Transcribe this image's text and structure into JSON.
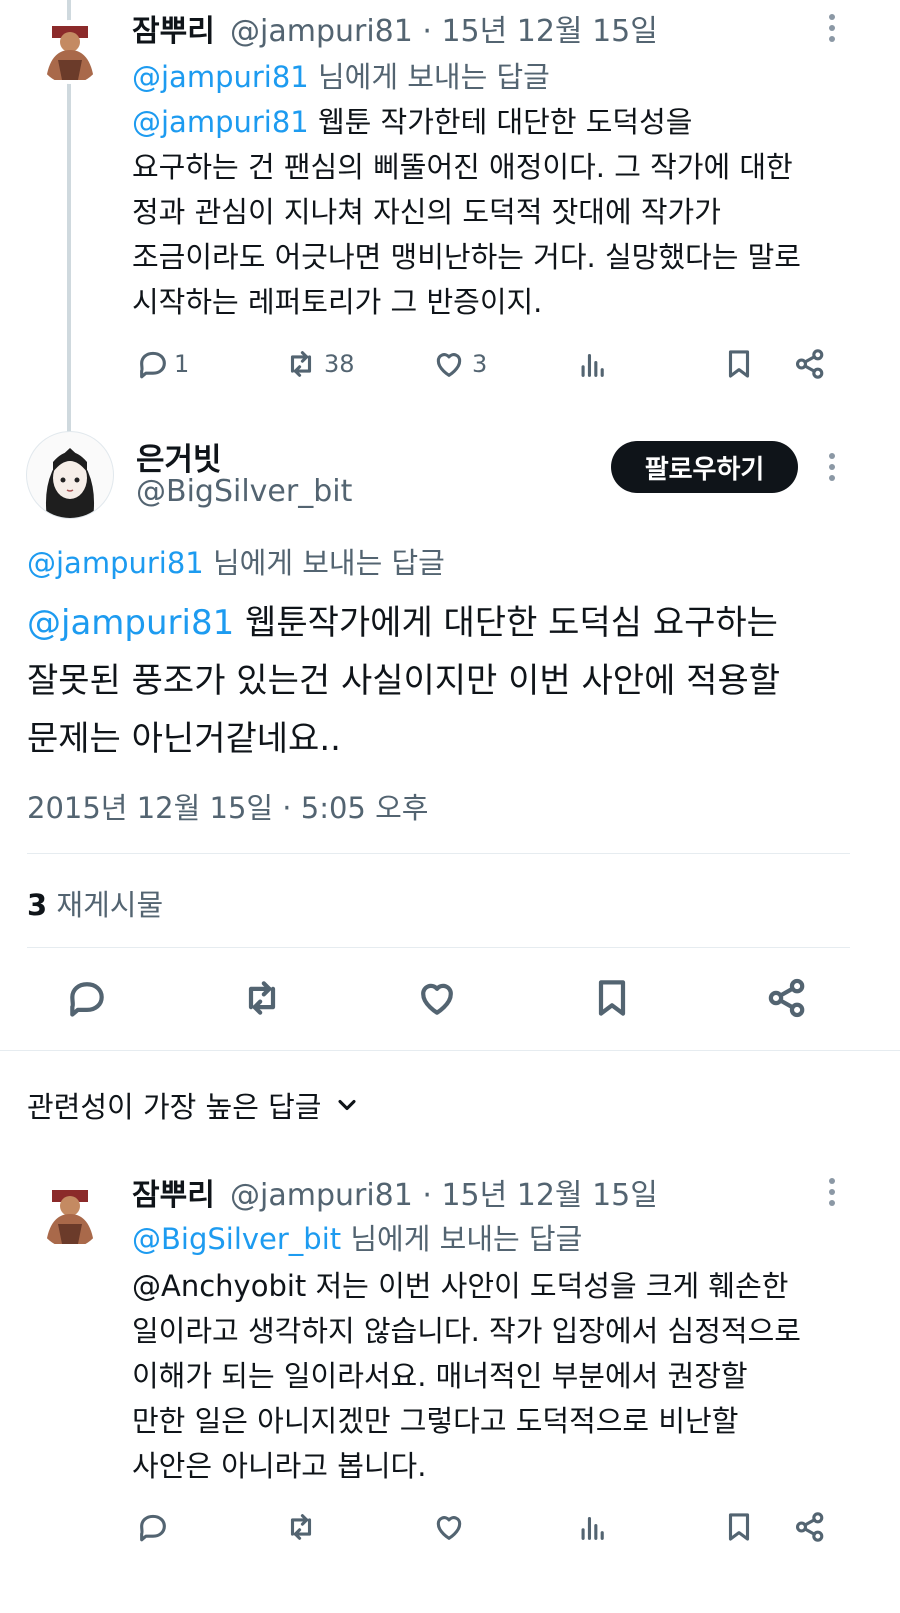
{
  "tweet1": {
    "name": "잠뿌리",
    "handle_date": "@jampuri81 · 15년 12월 15일",
    "reply_to_handle": "@jampuri81",
    "reply_to_suffix": " 님에게 보내는 답글",
    "mention": "@jampuri81",
    "line1": " 웹툰 작가한테 대단한 도덕성을",
    "line2": "요구하는 건 팬심의 삐뚤어진 애정이다. 그 작가에 대한",
    "line3": "정과 관심이 지나쳐 자신의 도덕적 잣대에 작가가",
    "line4": "조금이라도 어긋나면 맹비난하는 거다. 실망했다는 말로",
    "line5": "시작하는 레퍼토리가 그 반증이지.",
    "replies": "1",
    "retweets": "38",
    "likes": "3"
  },
  "main": {
    "name": "은거빗",
    "handle": "@BigSilver_bit",
    "follow_label": "팔로우하기",
    "reply_to_handle": "@jampuri81",
    "reply_to_suffix": " 님에게 보내는 답글",
    "mention": "@jampuri81",
    "line1": " 웹툰작가에게 대단한 도덕심 요구하는",
    "line2": "잘못된 풍조가 있는건 사실이지만 이번 사안에 적용할",
    "line3": "문제는 아닌거같네요..",
    "timestamp": "2015년 12월 15일 · 5:05 오후",
    "repost_count": "3",
    "repost_label": " 재게시물"
  },
  "sort_label": "관련성이 가장 높은 답글",
  "tweet2": {
    "name": "잠뿌리",
    "handle_date": "@jampuri81 · 15년 12월 15일",
    "reply_to_handle": "@BigSilver_bit",
    "reply_to_suffix": " 님에게 보내는 답글",
    "line1": "@Anchyobit 저는 이번 사안이 도덕성을 크게 훼손한",
    "line2": "일이라고 생각하지 않습니다. 작가 입장에서 심정적으로",
    "line3": "이해가 되는 일이라서요. 매너적인 부분에서 권장할",
    "line4": "만한 일은 아니지겠만 그렇다고 도덕적으로 비난할",
    "line5": "사안은 아니라고 봅니다."
  },
  "icons": [
    "reply-icon",
    "retweet-icon",
    "like-icon",
    "views-icon",
    "bookmark-icon",
    "share-icon",
    "more-icon",
    "chevron-down-icon"
  ]
}
